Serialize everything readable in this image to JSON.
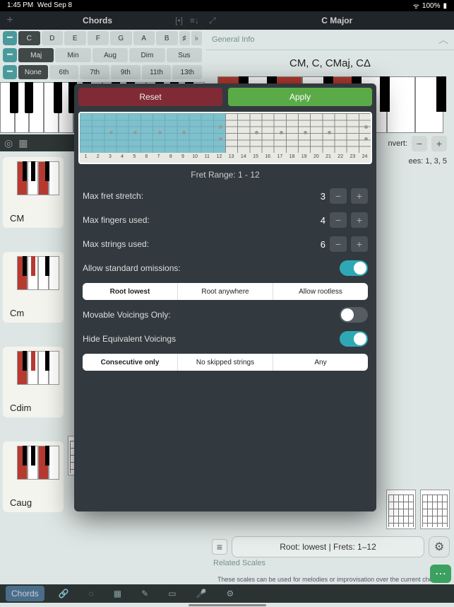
{
  "status": {
    "time": "1:45 PM",
    "date": "Wed Sep 8",
    "battery": "100%"
  },
  "topbar": {
    "leftTitle": "Chords",
    "rightTitle": "C Major"
  },
  "noteRow": [
    "C",
    "D",
    "E",
    "F",
    "G",
    "A",
    "B"
  ],
  "qualityRow": [
    "Maj",
    "Min",
    "Aug",
    "Dim",
    "Sus"
  ],
  "extRow": [
    "None",
    "6th",
    "7th",
    "9th",
    "11th",
    "13th"
  ],
  "chordCards": [
    "CM",
    "Cm",
    "Cdim",
    "Caug"
  ],
  "right": {
    "sectionLabel": "General Info",
    "chordAliases": "CM, C, CMaj, CΔ",
    "invertLabel": "nvert:",
    "degreesLabel": "ees: 1, 3, 5",
    "voiceSummary": "Root: lowest  |  Frets: 1–12",
    "relatedLabel": "Related Scales",
    "relatedSub": "These scales can be used for melodies or improvisation over the current chord"
  },
  "bottomTabs": {
    "active": "Chords"
  },
  "modal": {
    "resetLabel": "Reset",
    "applyLabel": "Apply",
    "fretRangeLabel": "Fret Range: 1 - 12",
    "fretNumbers": [
      "1",
      "2",
      "3",
      "4",
      "5",
      "6",
      "7",
      "8",
      "9",
      "10",
      "11",
      "12",
      "13",
      "14",
      "15",
      "16",
      "17",
      "18",
      "19",
      "20",
      "21",
      "22",
      "23",
      "24"
    ],
    "rows": {
      "maxStretch": {
        "label": "Max fret stretch:",
        "value": "3"
      },
      "maxFingers": {
        "label": "Max fingers used:",
        "value": "4"
      },
      "maxStrings": {
        "label": "Max strings used:",
        "value": "6"
      },
      "omissions": {
        "label": "Allow standard omissions:"
      },
      "movable": {
        "label": "Movable Voicings Only:"
      },
      "hideEq": {
        "label": "Hide Equivalent Voicings"
      }
    },
    "rootSeg": [
      "Root lowest",
      "Root anywhere",
      "Allow rootless"
    ],
    "skipSeg": [
      "Consecutive only",
      "No skipped strings",
      "Any"
    ]
  }
}
